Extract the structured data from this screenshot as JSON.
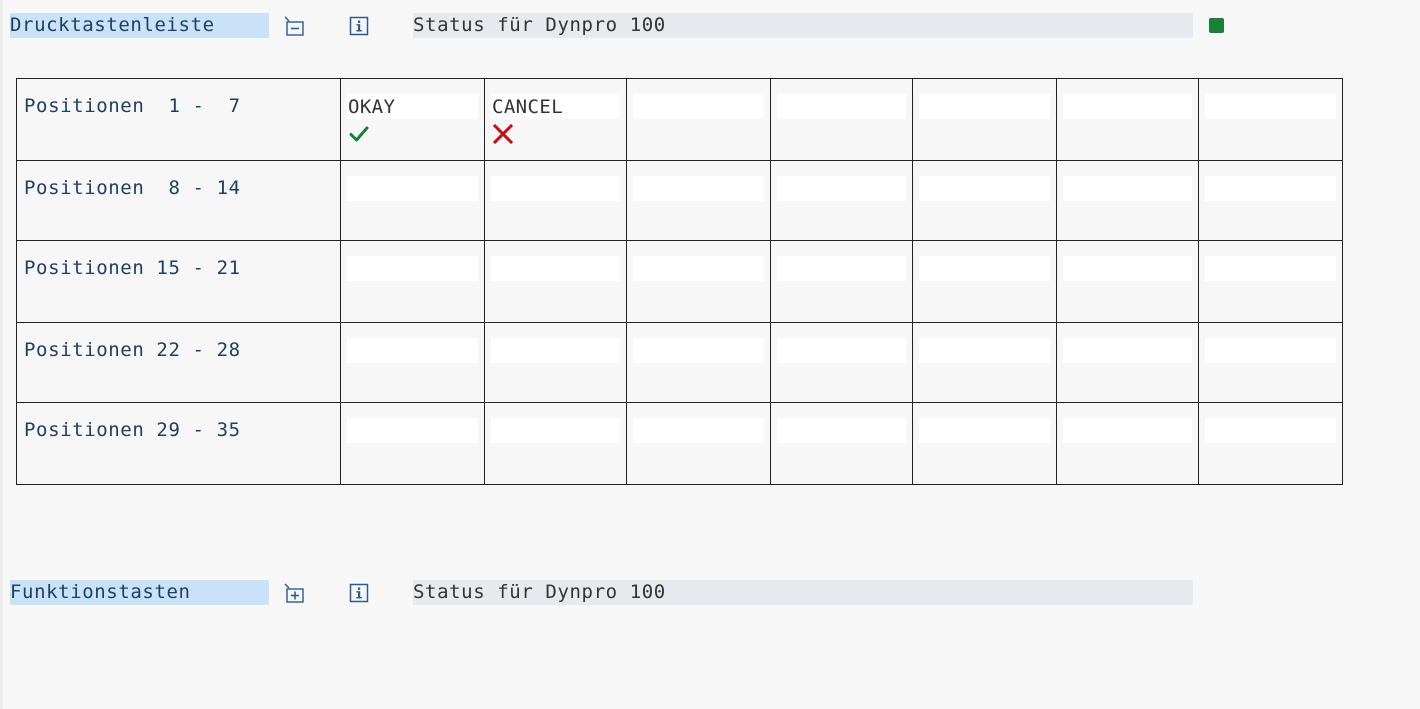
{
  "sections": {
    "pushbuttons": {
      "label": "Drucktastenleiste",
      "status_text": "Status für Dynpro 100",
      "status_indicator_color": "#1a7f37",
      "expand_icon": "collapse-minus-icon",
      "info_icon": "info-icon"
    },
    "function_keys": {
      "label": "Funktionstasten",
      "status_text": "Status für Dynpro 100",
      "expand_icon": "expand-plus-icon",
      "info_icon": "info-icon"
    }
  },
  "grid": {
    "rows": [
      {
        "label": "Positionen  1 -  7",
        "slots": [
          {
            "text": "OKAY",
            "icon": "checkmark-icon",
            "icon_color": "#1a7f37"
          },
          {
            "text": "CANCEL",
            "icon": "cancel-x-icon",
            "icon_color": "#c0101a"
          },
          {
            "text": ""
          },
          {
            "text": ""
          },
          {
            "text": ""
          },
          {
            "text": ""
          },
          {
            "text": ""
          }
        ]
      },
      {
        "label": "Positionen  8 - 14",
        "slots": [
          {
            "text": ""
          },
          {
            "text": ""
          },
          {
            "text": ""
          },
          {
            "text": ""
          },
          {
            "text": ""
          },
          {
            "text": ""
          },
          {
            "text": ""
          }
        ]
      },
      {
        "label": "Positionen 15 - 21",
        "slots": [
          {
            "text": ""
          },
          {
            "text": ""
          },
          {
            "text": ""
          },
          {
            "text": ""
          },
          {
            "text": ""
          },
          {
            "text": ""
          },
          {
            "text": ""
          }
        ]
      },
      {
        "label": "Positionen 22 - 28",
        "slots": [
          {
            "text": ""
          },
          {
            "text": ""
          },
          {
            "text": ""
          },
          {
            "text": ""
          },
          {
            "text": ""
          },
          {
            "text": ""
          },
          {
            "text": ""
          }
        ]
      },
      {
        "label": "Positionen 29 - 35",
        "slots": [
          {
            "text": ""
          },
          {
            "text": ""
          },
          {
            "text": ""
          },
          {
            "text": ""
          },
          {
            "text": ""
          },
          {
            "text": ""
          },
          {
            "text": ""
          }
        ]
      }
    ]
  }
}
